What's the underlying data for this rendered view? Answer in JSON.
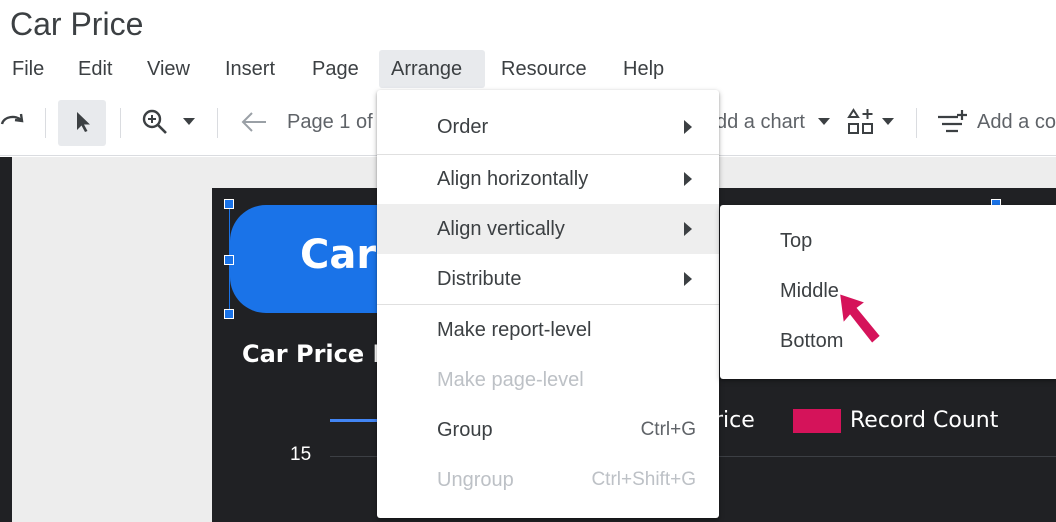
{
  "app": {
    "title": "Car Price"
  },
  "menubar": {
    "items": [
      "File",
      "Edit",
      "View",
      "Insert",
      "Page",
      "Arrange",
      "Resource",
      "Help"
    ],
    "active": "Arrange"
  },
  "toolbar": {
    "page_label": "Page 1 of",
    "add_chart_label": "dd a chart",
    "add_control_label": "Add a co"
  },
  "report": {
    "banner_title": "Car",
    "subtitle": "Car Price I",
    "legend": {
      "price_label": "rice",
      "count_label": "Record Count",
      "count_color": "#d5135a",
      "price_color": "#4285f4"
    },
    "y_tick": "15"
  },
  "arrange_menu": {
    "items": [
      {
        "label": "Order",
        "submenu": true
      },
      {
        "label": "Align horizontally",
        "submenu": true
      },
      {
        "label": "Align vertically",
        "submenu": true,
        "highlighted": true
      },
      {
        "label": "Distribute",
        "submenu": true
      },
      {
        "label": "Make report-level"
      },
      {
        "label": "Make page-level",
        "disabled": true
      },
      {
        "label": "Group",
        "shortcut": "Ctrl+G"
      },
      {
        "label": "Ungroup",
        "shortcut": "Ctrl+Shift+G",
        "disabled": true
      }
    ]
  },
  "align_vertically_submenu": {
    "items": [
      "Top",
      "Middle",
      "Bottom"
    ],
    "pointer_target": "Middle"
  },
  "colors": {
    "accent": "#1a73e8",
    "report_bg": "#202124",
    "pointer": "#d5135a"
  }
}
